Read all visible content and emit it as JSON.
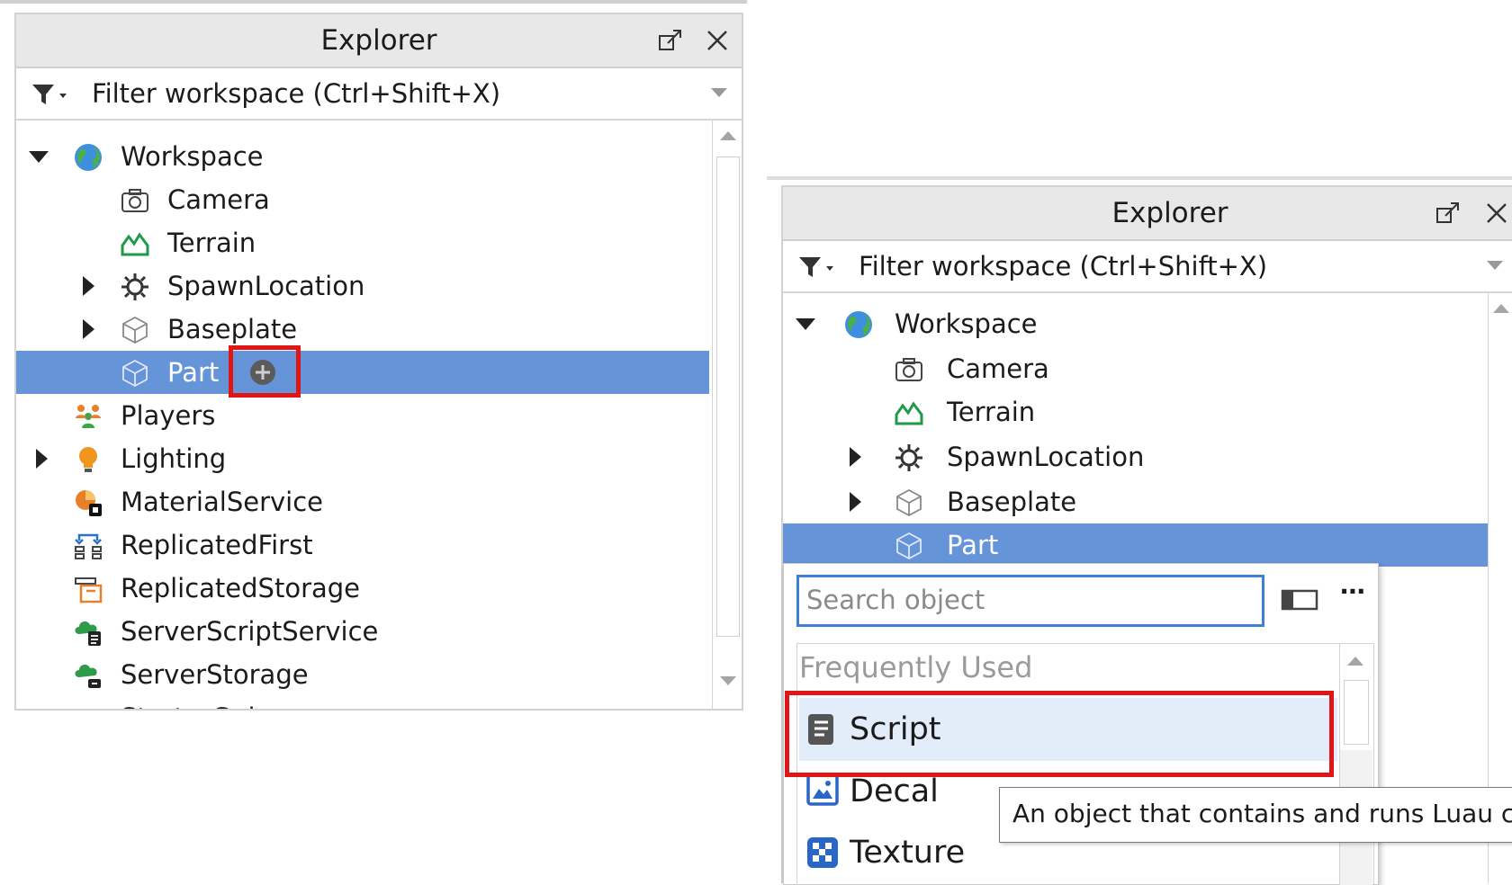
{
  "left_explorer": {
    "title": "Explorer",
    "filter_placeholder": "Filter workspace (Ctrl+Shift+X)",
    "tree": [
      {
        "label": "Workspace",
        "icon": "globe-icon",
        "expander": "expanded"
      },
      {
        "label": "Camera",
        "icon": "camera-icon",
        "expander": "none"
      },
      {
        "label": "Terrain",
        "icon": "terrain-icon",
        "expander": "none"
      },
      {
        "label": "SpawnLocation",
        "icon": "gear-icon",
        "expander": "collapsed"
      },
      {
        "label": "Baseplate",
        "icon": "cube-icon",
        "expander": "collapsed"
      },
      {
        "label": "Part",
        "icon": "cube-icon",
        "expander": "none",
        "selected": true
      },
      {
        "label": "Players",
        "icon": "players-icon",
        "expander": "none"
      },
      {
        "label": "Lighting",
        "icon": "lightbulb-icon",
        "expander": "collapsed"
      },
      {
        "label": "MaterialService",
        "icon": "material-service-icon",
        "expander": "none"
      },
      {
        "label": "ReplicatedFirst",
        "icon": "replicated-first-icon",
        "expander": "none"
      },
      {
        "label": "ReplicatedStorage",
        "icon": "replicated-storage-icon",
        "expander": "none"
      },
      {
        "label": "ServerScriptService",
        "icon": "server-script-service-icon",
        "expander": "none"
      },
      {
        "label": "ServerStorage",
        "icon": "server-storage-icon",
        "expander": "none"
      },
      {
        "label": "StarterGui",
        "icon": "folder-icon",
        "expander": "none"
      }
    ],
    "insert_button_icon": "plus-circle-icon"
  },
  "right_explorer": {
    "title": "Explorer",
    "filter_placeholder": "Filter workspace (Ctrl+Shift+X)",
    "tree": [
      {
        "label": "Workspace",
        "icon": "globe-icon",
        "expander": "expanded"
      },
      {
        "label": "Camera",
        "icon": "camera-icon",
        "expander": "none"
      },
      {
        "label": "Terrain",
        "icon": "terrain-icon",
        "expander": "none"
      },
      {
        "label": "SpawnLocation",
        "icon": "gear-icon",
        "expander": "collapsed"
      },
      {
        "label": "Baseplate",
        "icon": "cube-icon",
        "expander": "collapsed"
      },
      {
        "label": "Part",
        "icon": "cube-icon",
        "expander": "none",
        "selected": true
      }
    ],
    "insert_menu": {
      "search_placeholder": "Search object",
      "section_label": "Frequently Used",
      "items": [
        {
          "label": "Script",
          "icon": "script-icon",
          "highlighted": true
        },
        {
          "label": "Decal",
          "icon": "decal-icon"
        },
        {
          "label": "Texture",
          "icon": "texture-icon"
        }
      ],
      "tooltip": "An object that contains and runs Luau co"
    }
  },
  "colors": {
    "selection": "#6694d9",
    "highlight_box": "#e01515",
    "search_border": "#3f7fd6",
    "menu_item_highlight": "#e3ecf9"
  }
}
